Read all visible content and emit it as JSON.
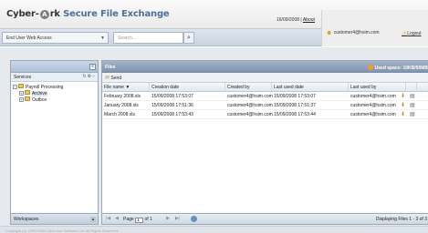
{
  "header": {
    "logo_part1": "Cyber-",
    "logo_letter": "A",
    "logo_part2": "rk",
    "logo_part3": "Secure File Exchange",
    "date": "16/09/2008 |",
    "about": "About"
  },
  "nav": {
    "access_select": "End User Web Access",
    "search_placeholder": "Search...",
    "user_email": "customer4@hsim.com",
    "logout": "Logout"
  },
  "left_panel": {
    "section": "Services",
    "tree": [
      {
        "label": "Payroll Processing",
        "level": 0,
        "expander": "−"
      },
      {
        "label": "Archive",
        "level": 1,
        "expander": "+"
      },
      {
        "label": "Outbox",
        "level": 1,
        "expander": "+"
      }
    ],
    "footer": "Workspaces"
  },
  "main_panel": {
    "title": "Files",
    "used_space": "Used space: 10KB/50MB",
    "send": "Send",
    "columns": [
      "File name",
      "Creation date",
      "Created by",
      "Last used date",
      "Last used by"
    ],
    "sort_indicator": "▼",
    "rows": [
      {
        "name": "February 2008.xls",
        "created": "15/09/2008 17:53:07",
        "created_by": "customer4@hsim.com",
        "last_used": "15/09/2008 17:53:07",
        "last_by": "customer4@hsim.com"
      },
      {
        "name": "January 2008.xls",
        "created": "15/09/2008 17:51:36",
        "created_by": "customer4@hsim.com",
        "last_used": "15/09/2008 17:51:37",
        "last_by": "customer4@hsim.com"
      },
      {
        "name": "March 2008.xls",
        "created": "15/09/2008 17:53:43",
        "created_by": "customer4@hsim.com",
        "last_used": "15/09/2008 17:53:44",
        "last_by": "customer4@hsim.com"
      }
    ],
    "pager": {
      "page_label": "Page",
      "page_value": "1",
      "of_label": "of 1",
      "display": "Displaying Files 1 - 3 of 3"
    }
  },
  "status": "Copyright (c) 1999-2008 Cyber-Ark Software Ltd. All Rights Reserved."
}
